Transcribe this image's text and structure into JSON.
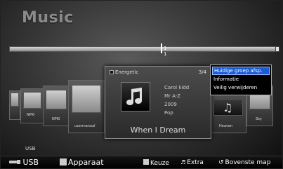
{
  "app": {
    "title": "Music"
  },
  "progress": {
    "fraction": 0.5,
    "text_top": "1",
    "text_bottom": "1"
  },
  "folders": {
    "left": [
      "NPKI",
      "NPKI",
      "usermanual"
    ],
    "right": [
      "Heaven",
      "Sky"
    ]
  },
  "info_panel": {
    "category": "Energetic",
    "count": "3/4",
    "artist": "Carol kidd",
    "sort": "Mr A-Z",
    "year": "2009",
    "genre": "Pop",
    "song_title": "When I Dream"
  },
  "context_menu": {
    "items": [
      "Huidige groep afsp.",
      "Informatie",
      "Veilig verwijderen"
    ],
    "selected_index": 0
  },
  "device": {
    "label": "USB"
  },
  "bottom_bar": {
    "usb": "USB",
    "device": "Apparaat",
    "select": "Keuze",
    "extra": "Extra",
    "top_folder": "Bovenste map"
  },
  "icons": {
    "usb": "usb-icon",
    "note": "music-note-icon",
    "extra": "extra-icon",
    "return": "return-icon"
  }
}
